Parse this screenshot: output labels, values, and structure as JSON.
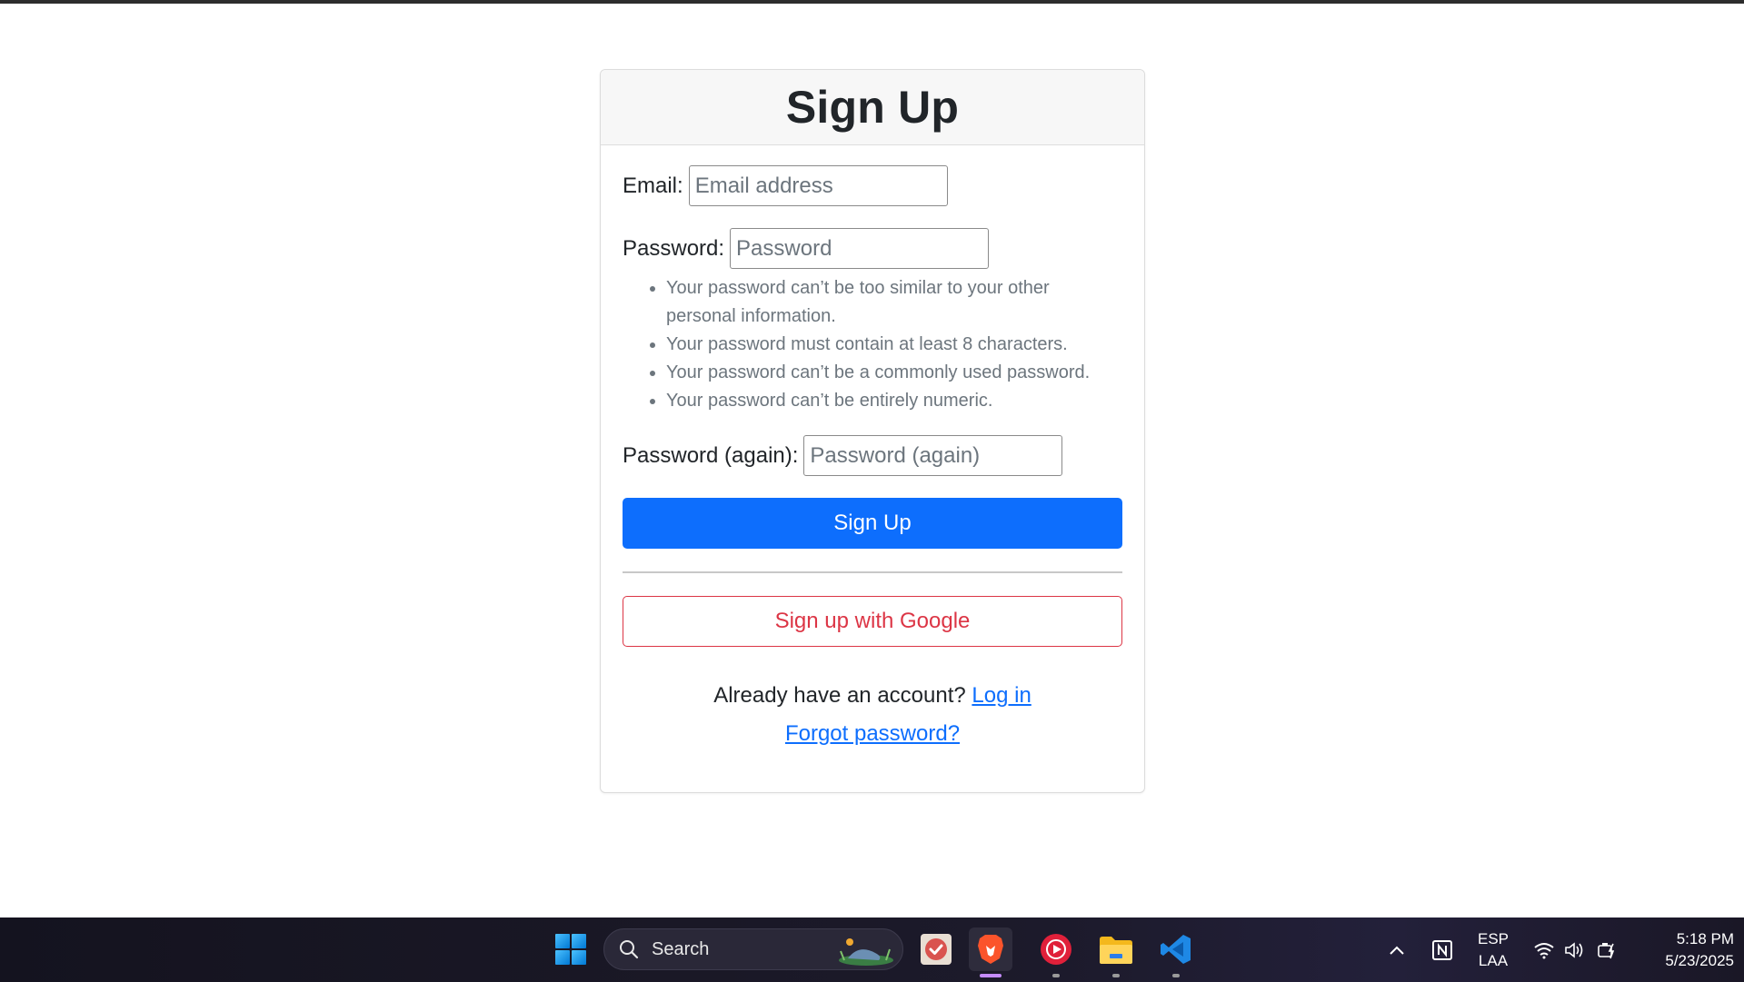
{
  "form": {
    "title": "Sign Up",
    "email": {
      "label": "Email:",
      "placeholder": "Email address",
      "value": ""
    },
    "password": {
      "label": "Password:",
      "placeholder": "Password",
      "value": ""
    },
    "help_texts": [
      "Your password can’t be too similar to your other personal information.",
      "Your password must contain at least 8 characters.",
      "Your password can’t be a commonly used password.",
      "Your password can’t be entirely numeric."
    ],
    "password_again": {
      "label": "Password (again):",
      "placeholder": "Password (again)",
      "value": ""
    },
    "submit_label": "Sign Up",
    "google_label": "Sign up with Google",
    "login_prompt": "Already have an account?",
    "login_link": "Log in",
    "forgot_link": "Forgot password?"
  },
  "colors": {
    "primary": "#0d6efd",
    "danger": "#dc3545",
    "muted": "#6c757d"
  },
  "taskbar": {
    "search_label": "Search",
    "apps": [
      "windows-start-icon",
      "todo-icon",
      "brave-browser-icon",
      "music-player-icon",
      "file-explorer-icon",
      "vscode-icon"
    ],
    "language": {
      "line1": "ESP",
      "line2": "LAA"
    },
    "time": "5:18 PM",
    "date": "5/23/2025"
  }
}
